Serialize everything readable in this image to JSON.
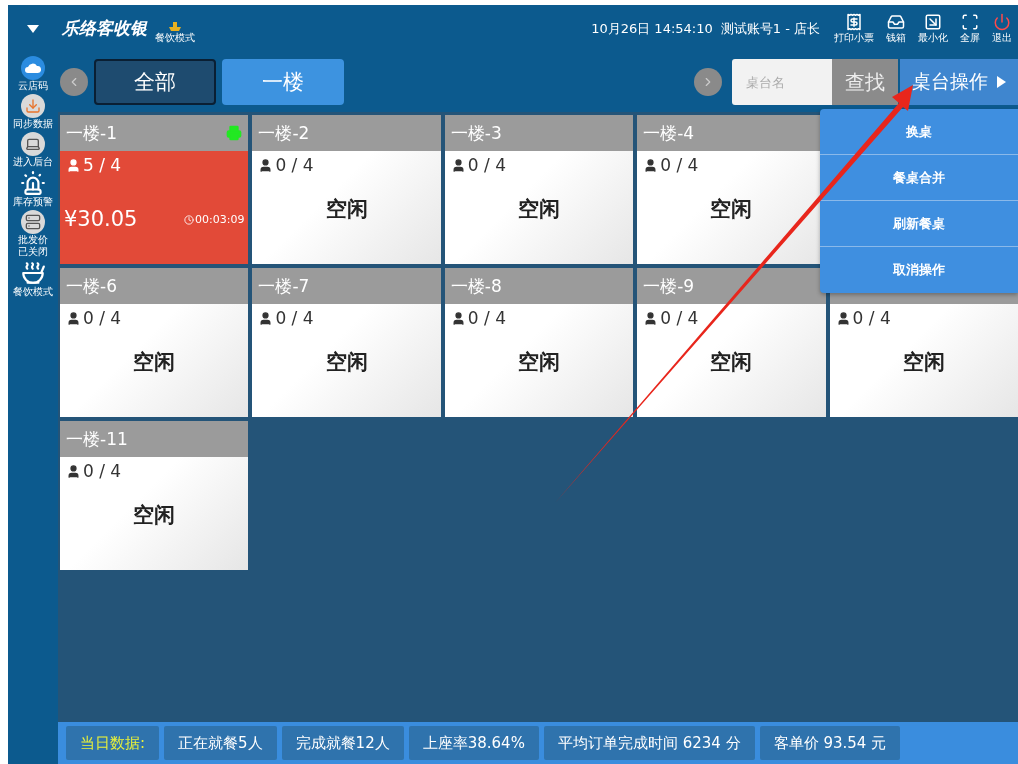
{
  "header": {
    "logo": "乐络客收银",
    "mode": "餐饮模式",
    "datetime": "10月26日 14:54:10",
    "account": "测试账号1 - 店长",
    "tools": [
      {
        "kind": "print",
        "label": "打印小票"
      },
      {
        "kind": "cashbox",
        "label": "钱箱"
      },
      {
        "kind": "minimize",
        "label": "最小化"
      },
      {
        "kind": "fullscreen",
        "label": "全屏"
      },
      {
        "kind": "exit",
        "label": "退出"
      }
    ]
  },
  "sidebar": {
    "items": [
      {
        "kind": "cloud",
        "label": "云店码"
      },
      {
        "kind": "sync",
        "label": "同步数据"
      },
      {
        "kind": "backend",
        "label": "进入后台"
      },
      {
        "kind": "alarm",
        "label": "库存预警"
      },
      {
        "kind": "wholesale",
        "label": "批发价已关闭"
      },
      {
        "kind": "dining",
        "label": "餐饮模式"
      }
    ]
  },
  "tabs": [
    {
      "label": "全部",
      "selected": false
    },
    {
      "label": "一楼",
      "selected": true
    }
  ],
  "search": {
    "placeholder": "桌台名",
    "button": "查找"
  },
  "table_ops": {
    "label": "桌台操作",
    "expanded": true,
    "menu": [
      "换桌",
      "餐桌合并",
      "刷新餐桌",
      "取消操作"
    ]
  },
  "tables": [
    {
      "kind": "occupied",
      "name": "一楼-1",
      "guests": "5 / 4",
      "amount": "¥30.05",
      "duration": "00:03:09"
    },
    {
      "kind": "idle",
      "name": "一楼-2",
      "guests": "0 / 4",
      "status": "空闲"
    },
    {
      "kind": "idle",
      "name": "一楼-3",
      "guests": "0 / 4",
      "status": "空闲"
    },
    {
      "kind": "idle",
      "name": "一楼-4",
      "guests": "0 / 4",
      "status": "空闲"
    },
    {
      "kind": "hidden"
    },
    {
      "kind": "idle",
      "name": "一楼-6",
      "guests": "0 / 4",
      "status": "空闲"
    },
    {
      "kind": "idle",
      "name": "一楼-7",
      "guests": "0 / 4",
      "status": "空闲"
    },
    {
      "kind": "idle",
      "name": "一楼-8",
      "guests": "0 / 4",
      "status": "空闲"
    },
    {
      "kind": "idle",
      "name": "一楼-9",
      "guests": "0 / 4",
      "status": "空闲"
    },
    {
      "kind": "idle",
      "guests": "0 / 4",
      "status": "空闲"
    },
    {
      "kind": "idle",
      "name": "一楼-11",
      "guests": "0 / 4",
      "status": "空闲"
    }
  ],
  "status_bar": {
    "title": "当日数据:",
    "stats": [
      "正在就餐5人",
      "完成就餐12人",
      "上座率38.64%",
      "平均订单完成时间 6234 分",
      "客单价 93.54 元"
    ]
  }
}
